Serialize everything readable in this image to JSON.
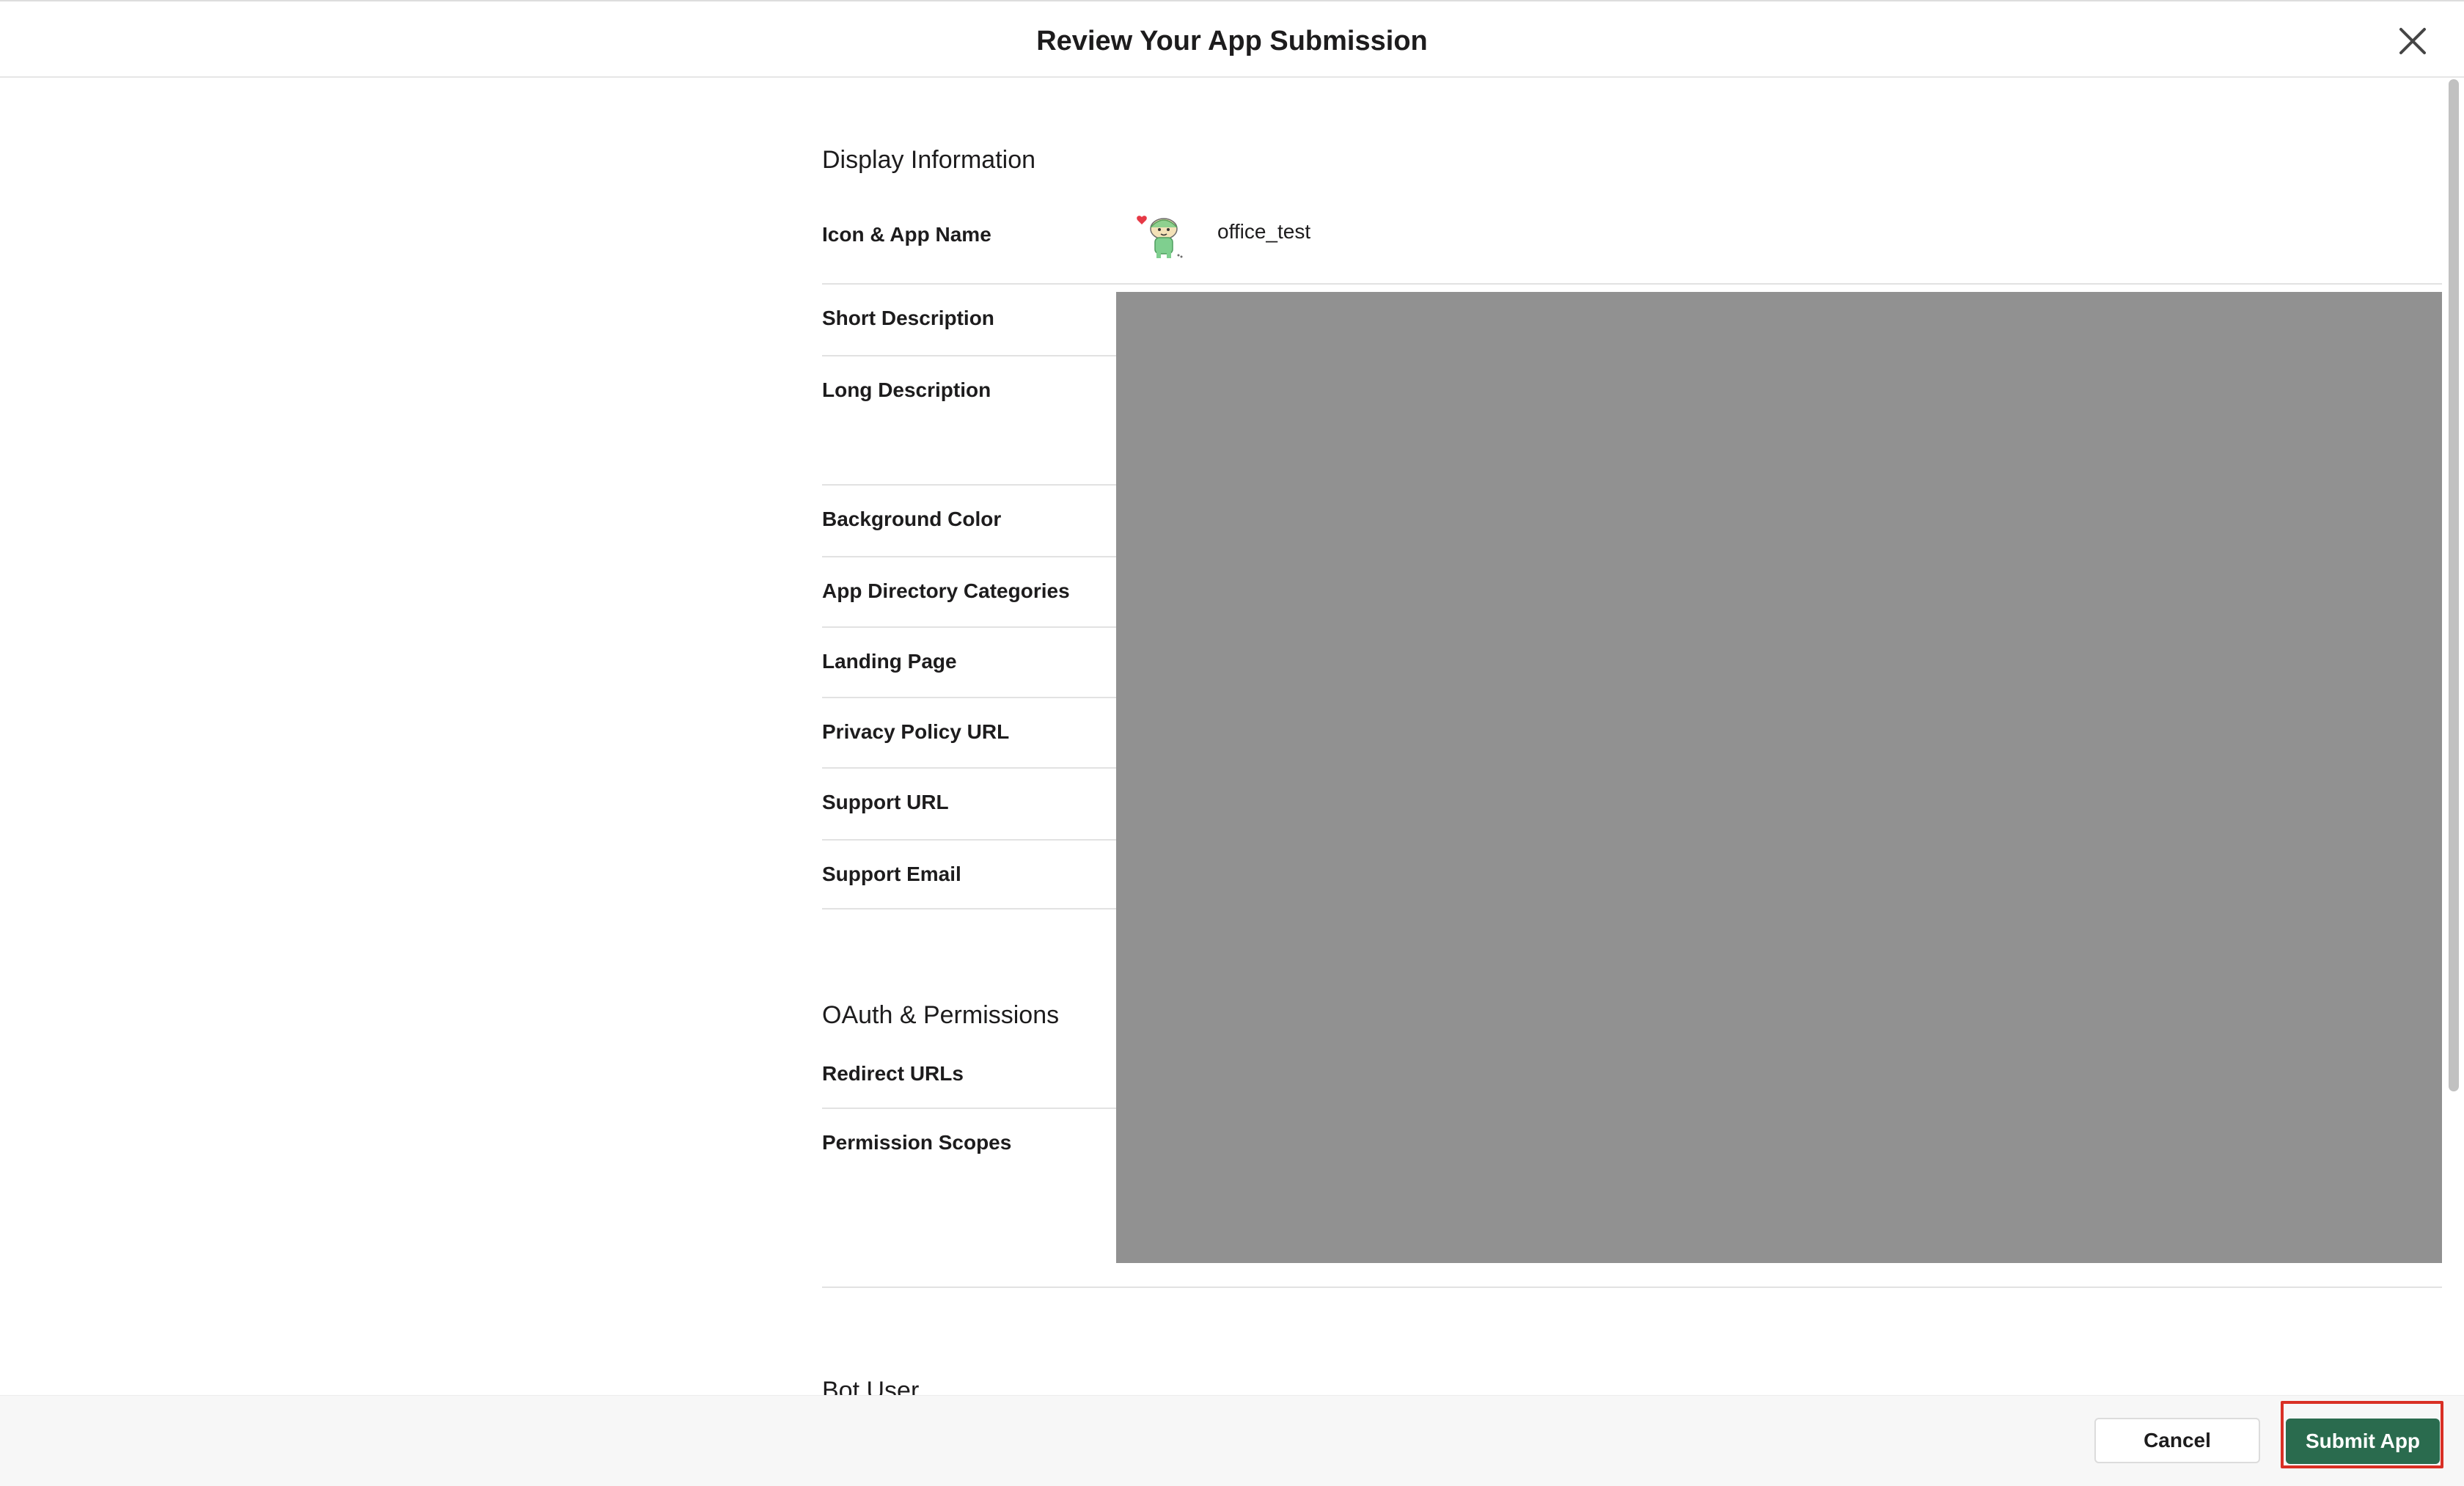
{
  "header": {
    "title": "Review Your App Submission",
    "close_icon": "close-icon"
  },
  "display_information": {
    "heading": "Display Information",
    "rows": [
      {
        "label": "Icon & App Name",
        "value": "office_test"
      },
      {
        "label": "Short Description"
      },
      {
        "label": "Long Description"
      },
      {
        "label": "Background Color"
      },
      {
        "label": "App Directory Categories"
      },
      {
        "label": "Landing Page"
      },
      {
        "label": "Privacy Policy URL"
      },
      {
        "label": "Support URL"
      },
      {
        "label": "Support Email"
      }
    ]
  },
  "oauth": {
    "heading": "OAuth & Permissions",
    "rows": [
      {
        "label": "Redirect URLs"
      },
      {
        "label": "Permission Scopes"
      }
    ]
  },
  "bot_user": {
    "heading": "Bot User"
  },
  "footer": {
    "cancel_label": "Cancel",
    "submit_label": "Submit App"
  },
  "colors": {
    "submit_button": "#2a6b4e",
    "redacted_area": "#919191",
    "highlight_box": "#d93025"
  }
}
